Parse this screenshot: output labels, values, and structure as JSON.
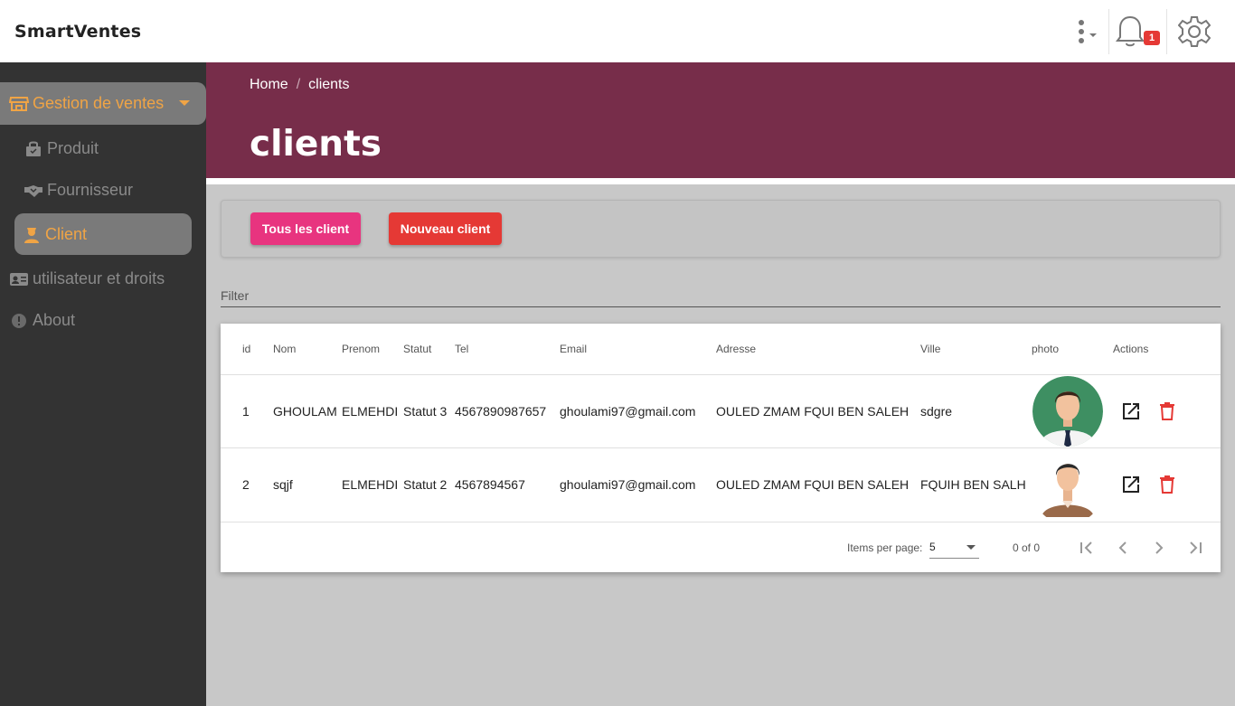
{
  "app": {
    "brand": "SmartVentes"
  },
  "topbar": {
    "notification_count": "1"
  },
  "sidebar": {
    "gestion": {
      "label": "Gestion de ventes"
    },
    "items": [
      {
        "label": "Produit"
      },
      {
        "label": "Fournisseur"
      },
      {
        "label": "Client"
      },
      {
        "label": "utilisateur et droits"
      },
      {
        "label": "About"
      }
    ]
  },
  "header": {
    "breadcrumb": {
      "home": "Home",
      "current": "clients"
    },
    "title": "clients"
  },
  "actions": {
    "all_label": "Tous les client",
    "new_label": "Nouveau client"
  },
  "filter": {
    "placeholder": "Filter"
  },
  "table": {
    "columns": [
      "id",
      "Nom",
      "Prenom",
      "Statut",
      "Tel",
      "Email",
      "Adresse",
      "Ville",
      "photo",
      "Actions"
    ],
    "rows": [
      {
        "id": "1",
        "nom": "GHOULAM",
        "prenom": "ELMEHDI",
        "statut": "Statut 3",
        "tel": "4567890987657",
        "email": "ghoulami97@gmail.com",
        "adresse": "OULED ZMAM FQUI BEN SALEH",
        "ville": "sdgre"
      },
      {
        "id": "2",
        "nom": "sqjf",
        "prenom": "ELMEHDI",
        "statut": "Statut 2",
        "tel": "4567894567",
        "email": "ghoulami97@gmail.com",
        "adresse": "OULED ZMAM FQUI BEN SALEH",
        "ville": "FQUIH BEN SALH"
      }
    ]
  },
  "paginator": {
    "items_per_page_label": "Items per page:",
    "page_size": "5",
    "range": "0 of 0"
  },
  "colors": {
    "header": "#772d4a",
    "sidebar": "#333333",
    "accent": "#f0a445",
    "btn_all": "#e8347f",
    "btn_new": "#e53935"
  }
}
